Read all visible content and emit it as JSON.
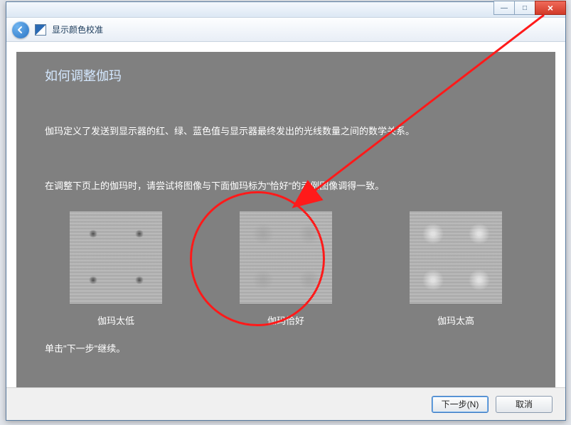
{
  "window": {
    "nav_title": "显示颜色校准"
  },
  "panel": {
    "title": "如何调整伽玛",
    "paragraph1": "伽玛定义了发送到显示器的红、绿、蓝色值与显示器最终发出的光线数量之间的数学关系。",
    "paragraph2": "在调整下页上的伽玛时，请尝试将图像与下面伽玛标为\"恰好\"的示例图像调得一致。",
    "samples": [
      {
        "label": "伽玛太低"
      },
      {
        "label": "伽玛恰好"
      },
      {
        "label": "伽玛太高"
      }
    ],
    "footer_text": "单击\"下一步\"继续。"
  },
  "buttons": {
    "next": "下一步(N)",
    "cancel": "取消"
  },
  "window_controls": {
    "minimize": "—",
    "maximize": "□",
    "close": "×"
  }
}
